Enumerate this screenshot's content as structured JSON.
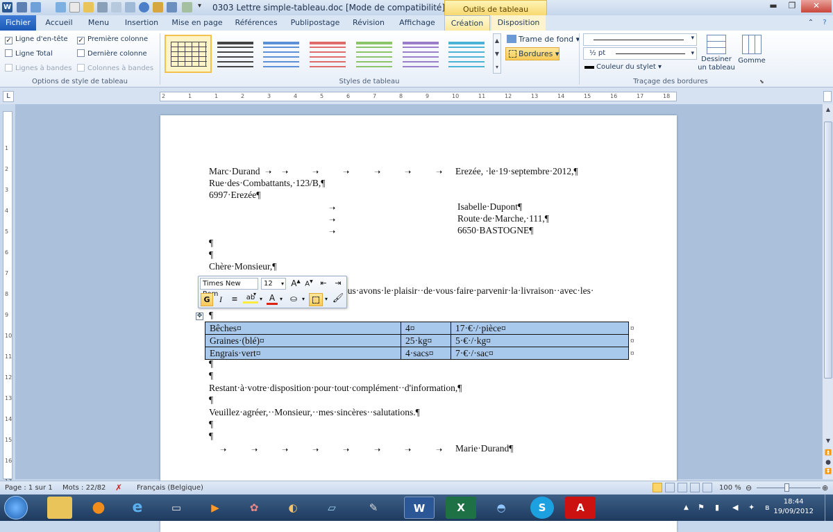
{
  "window": {
    "title": "0303 Lettre simple-tableau.doc [Mode de compatibilité] - Micr...",
    "contextual_tab_header": "Outils de tableau",
    "min": "▬",
    "restore": "❐",
    "close": "✕"
  },
  "tabs": {
    "file": "Fichier",
    "items": [
      "Accueil",
      "Menu",
      "Insertion",
      "Mise en page",
      "Références",
      "Publipostage",
      "Révision",
      "Affichage",
      "Création",
      "Disposition"
    ],
    "active": "Création"
  },
  "ribbon": {
    "style_options": {
      "items": [
        {
          "label": "Ligne d'en-tête",
          "checked": true
        },
        {
          "label": "Première colonne",
          "checked": true
        },
        {
          "label": "Ligne Total",
          "checked": false
        },
        {
          "label": "Dernière colonne",
          "checked": false
        },
        {
          "label": "Lignes à bandes",
          "checked": false,
          "disabled": true
        },
        {
          "label": "Colonnes à bandes",
          "checked": false,
          "disabled": true
        }
      ],
      "group_label": "Options de style de tableau"
    },
    "table_styles": {
      "group_label": "Styles de tableau",
      "colors": [
        "#444444",
        "#444444",
        "#5b8fd6",
        "#e06b6b",
        "#8cc46a",
        "#9b7ec9",
        "#4bb3d6"
      ]
    },
    "shading": {
      "label": "Trame de fond"
    },
    "borders": {
      "label": "Bordures"
    },
    "draw": {
      "pen_weight": "½ pt",
      "pen_color_label": "Couleur du stylet",
      "draw_table": "Dessiner un tableau",
      "eraser": "Gomme",
      "group_label": "Traçage des bordures"
    }
  },
  "ruler": {
    "numbers": [
      "2",
      "1",
      "1",
      "2",
      "3",
      "4",
      "5",
      "6",
      "7",
      "8",
      "9",
      "10",
      "11",
      "12",
      "13",
      "14",
      "15",
      "16",
      "17",
      "18"
    ]
  },
  "document": {
    "sender_name": "Marc·Durand",
    "date_line": "Erezée, ·le·19·septembre·2012,¶",
    "sender_street": "Rue·des·Combattants,·123/B,¶",
    "sender_city": "6997·Erezée¶",
    "recipient_name": "Isabelle·Dupont¶",
    "recipient_street": "Route·de·Marche,·111,¶",
    "recipient_city": "6650·BASTOGNE¶",
    "pilcrow": "¶",
    "salutation": "Chère·Monsieur,¶",
    "body_partial": "ous·avons·le·plaisir··de·vous·faire·parvenir·la·livraison··avec·les·",
    "table_rows": [
      [
        "Bêches¤",
        "4¤",
        "17·€·/·pièce¤",
        "¤"
      ],
      [
        "Graines·(blé)¤",
        "25·kg¤",
        "5·€·/·kg¤",
        "¤"
      ],
      [
        "Engrais·vert¤",
        "4·sacs¤",
        "7·€·/·sac¤",
        "¤"
      ]
    ],
    "closing1": "Restant·à·votre·disposition·pour·tout·complément··d'information,¶",
    "closing2": "Veuillez·agréer,··Monsieur,··mes·sincères··salutations.¶",
    "signature": "Marie·Durand¶"
  },
  "minitoolbar": {
    "font": "Times New Rom",
    "size": "12",
    "bold": "G",
    "italic": "I"
  },
  "status": {
    "page": "Page : 1 sur 1",
    "words": "Mots : 22/82",
    "language": "Français (Belgique)",
    "zoom": "100 %"
  },
  "taskbar": {
    "time": "18:44",
    "date": "19/09/2012",
    "active_app": "W"
  }
}
